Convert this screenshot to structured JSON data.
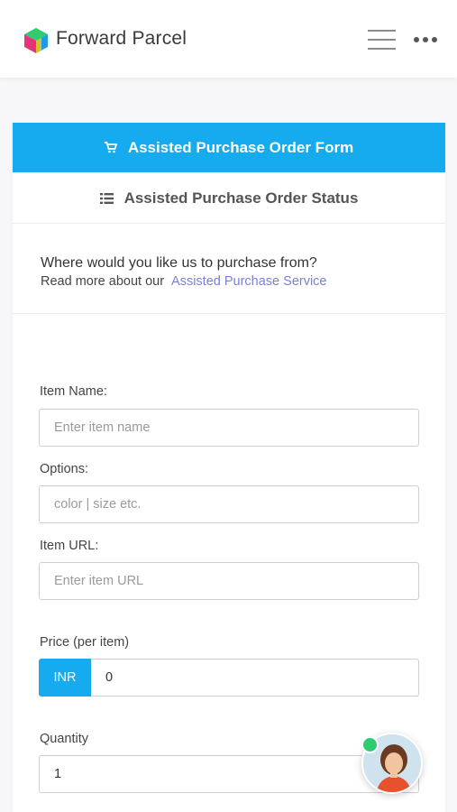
{
  "header": {
    "brand": "Forward Parcel",
    "logo_icon": "cube-logo-icon",
    "menu_icon": "hamburger-menu-icon",
    "more_icon": "more-dots-icon"
  },
  "tabs": {
    "order_form": {
      "label": "Assisted Purchase Order Form",
      "icon": "cart-icon"
    },
    "order_status": {
      "label": "Assisted Purchase Order Status",
      "icon": "list-icon"
    }
  },
  "intro": {
    "question": "Where would you like us to purchase from?",
    "read_more_prefix": "Read more about our",
    "read_more_link": "Assisted Purchase Service"
  },
  "form": {
    "item_name": {
      "label": "Item Name:",
      "placeholder": "Enter item name",
      "value": ""
    },
    "options": {
      "label": "Options:",
      "placeholder": "color | size etc.",
      "value": ""
    },
    "item_url": {
      "label": "Item URL:",
      "placeholder": "Enter item URL",
      "value": ""
    },
    "price": {
      "label": "Price (per item)",
      "currency": "INR",
      "value": "0"
    },
    "quantity": {
      "label": "Quantity",
      "value": "1"
    }
  },
  "colors": {
    "accent": "#16aaee",
    "link": "#7b7fd8",
    "online": "#2ecc71"
  },
  "chat_widget": {
    "icon": "support-agent-avatar-icon",
    "status": "online"
  }
}
